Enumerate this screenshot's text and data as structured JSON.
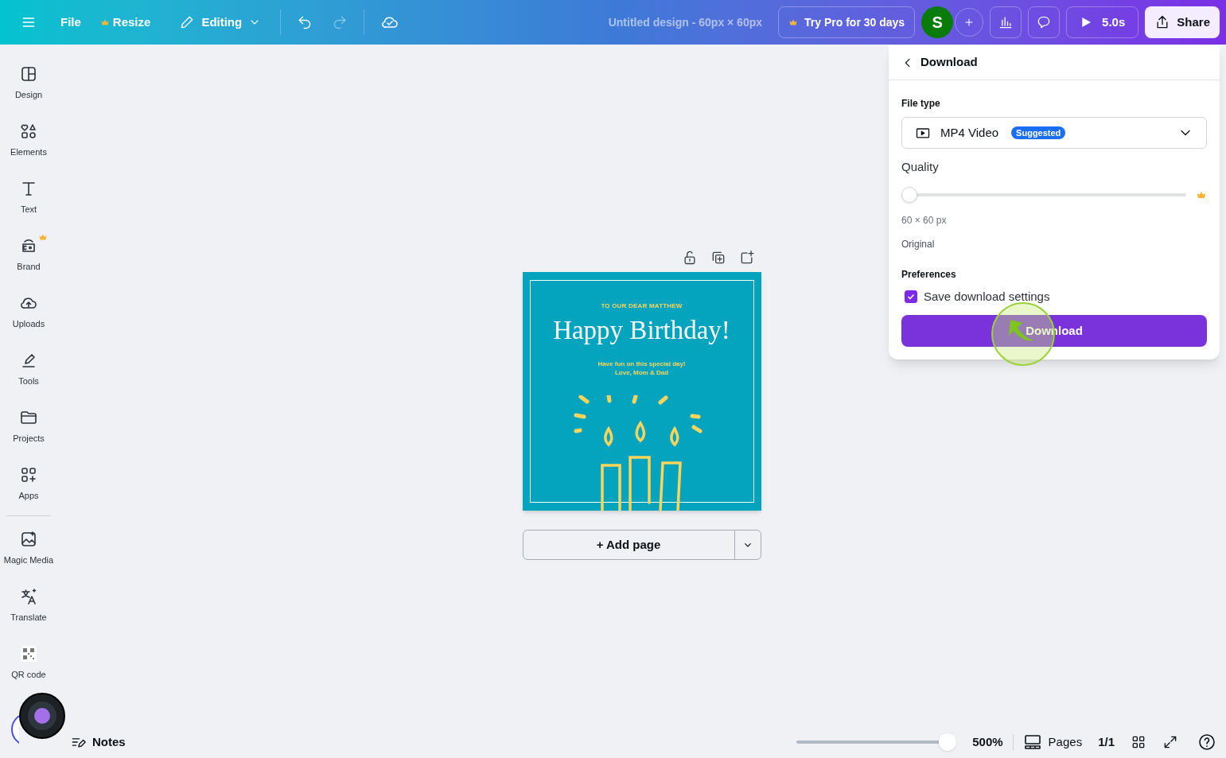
{
  "topbar": {
    "menu_items": [
      {
        "label": "File",
        "pro": false
      },
      {
        "label": "Resize",
        "pro": true
      }
    ],
    "mode": "Editing",
    "title": "Untitled design - 60px × 60px",
    "pro_button": "Try Pro for 30 days",
    "avatar": "S",
    "play_button": "5.0s",
    "share_button": "Share"
  },
  "sidebar": {
    "items": [
      {
        "label": "Design",
        "pro": false
      },
      {
        "label": "Elements",
        "pro": false
      },
      {
        "label": "Text",
        "pro": false
      },
      {
        "label": "Brand",
        "pro": true
      },
      {
        "label": "Uploads",
        "pro": false
      },
      {
        "label": "Tools",
        "pro": false
      },
      {
        "label": "Projects",
        "pro": false
      },
      {
        "label": "Apps",
        "pro": false
      }
    ],
    "extra_items": [
      {
        "label": "Magic Media"
      },
      {
        "label": "Translate"
      },
      {
        "label": "QR code"
      }
    ]
  },
  "design": {
    "heading": "TO OUR DEAR MATTHEW",
    "title": "Happy Birthday!",
    "message": "Have fun on this special day!",
    "signature": "Love, Mom & Dad"
  },
  "add_page": "+ Add page",
  "download_panel": {
    "title": "Download",
    "file_type_label": "File type",
    "file_type": "MP4 Video",
    "badge": "Suggested",
    "quality_label": "Quality",
    "quality": {
      "level": 0
    },
    "size": "60 × 60 px",
    "size_note": "Original",
    "preferences_label": "Preferences",
    "save_settings": {
      "label": "Save download settings",
      "checked": true
    },
    "button": "Download"
  },
  "footer": {
    "notes": "Notes",
    "zoom": {
      "level": 1
    },
    "zoom_reading": "500%",
    "pages": "Pages",
    "page_count": "1/1"
  }
}
